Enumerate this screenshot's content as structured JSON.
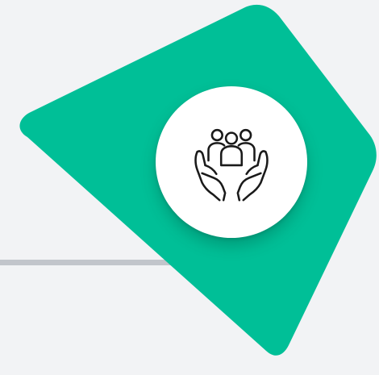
{
  "graphic": {
    "accent_color": "#00bf97",
    "background_color": "#f2f3f5",
    "line_color": "#c2c5cb",
    "circle_color": "#ffffff",
    "icon": "community-care-icon"
  }
}
